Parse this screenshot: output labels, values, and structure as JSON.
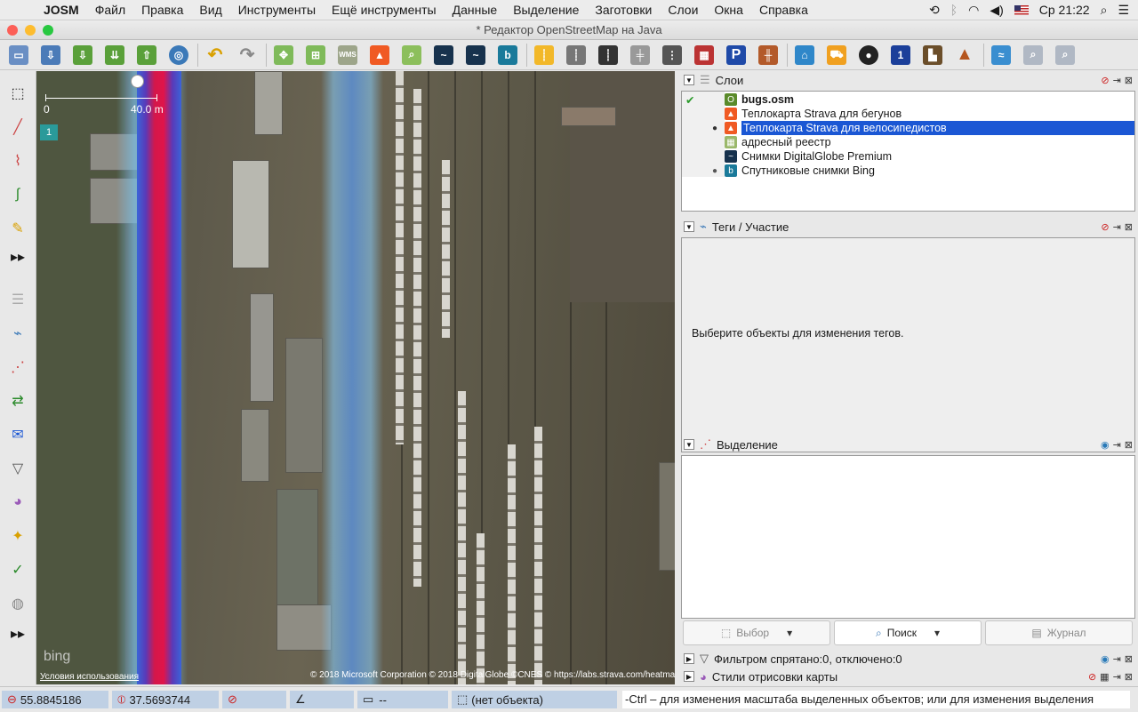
{
  "menubar": {
    "app": "JOSM",
    "items": [
      "Файл",
      "Правка",
      "Вид",
      "Инструменты",
      "Ещё инструменты",
      "Данные",
      "Выделение",
      "Заготовки",
      "Слои",
      "Окна",
      "Справка"
    ],
    "clock": "Ср 21:22"
  },
  "window": {
    "title": "* Редактор OpenStreetMap на Java"
  },
  "toolbar": {
    "icons": [
      "open-file",
      "save",
      "download",
      "download-along",
      "upload",
      "preferences",
      "undo",
      "redo",
      "zoom-in",
      "zoom-out",
      "wms",
      "strava",
      "search",
      "digitalglobe",
      "digitalglobe-2",
      "bing",
      "road-yellow",
      "road-gray",
      "road-dark",
      "rail",
      "traffic-light",
      "wall",
      "parking",
      "railway",
      "hotel",
      "shop",
      "soccer",
      "speed-limit",
      "industrial",
      "peak",
      "water",
      "zoom-data",
      "zoom-layer"
    ]
  },
  "map": {
    "scale_start": "0",
    "scale_label": "40.0 m",
    "layer_badge": "1",
    "attribution": "© 2018 Microsoft Corporation © 2018 DigitalGlobe ©CNES © https://labs.strava.com/heatmap",
    "terms": "Условия использования",
    "bing_watermark": "bing"
  },
  "panels": {
    "layers": {
      "title": "Слои",
      "items": [
        {
          "name": "bugs.osm",
          "visible": "",
          "bold": true,
          "icon": "OSM",
          "color": "#5a8a2a"
        },
        {
          "name": "Теплокарта Strava для бегунов",
          "visible": "",
          "icon": "S",
          "color": "#f05a23"
        },
        {
          "name": "Теплокарта Strava для велосипедистов",
          "visible": "●",
          "icon": "S",
          "color": "#f05a23"
        },
        {
          "name": "адресный реестр",
          "visible": "",
          "icon": "A",
          "color": "#9ab86a"
        },
        {
          "name": "Снимки DigitalGlobe Premium",
          "visible": "",
          "icon": "~",
          "color": "#17324d"
        },
        {
          "name": "Спутниковые снимки Bing",
          "visible": "●",
          "icon": "b",
          "color": "#1a7a9a"
        }
      ]
    },
    "tags": {
      "title": "Теги / Участие",
      "empty_message": "Выберите объекты для изменения тегов."
    },
    "selection": {
      "title": "Выделение",
      "buttons": {
        "select": "Выбор",
        "search": "Поиск",
        "history": "Журнал"
      }
    },
    "filters": {
      "title": "Фильтром спрятано:0, отключено:0"
    },
    "styles": {
      "title": "Стили отрисовки карты"
    }
  },
  "status": {
    "lat": "55.8845186",
    "lon": "37.5693744",
    "heading": "",
    "angle": "",
    "length": "--",
    "object": "(нет объекта)",
    "hint": "-Ctrl – для изменения масштаба выделенных объектов; или для изменения выделения"
  }
}
